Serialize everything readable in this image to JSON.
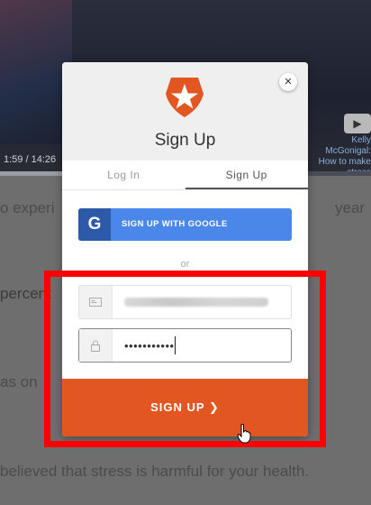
{
  "background": {
    "video_time": "1:59 / 14:26",
    "line_1": "o experi",
    "line_1_right": "year",
    "line_2": "percent",
    "line_3": "as on",
    "line_4": "believed that stress is harmful for your health.",
    "side_text": "Kelly McGonigal: How to make stress"
  },
  "modal": {
    "title": "Sign Up",
    "close_symbol": "×",
    "tabs": [
      {
        "label": "Log In",
        "active": false
      },
      {
        "label": "Sign Up",
        "active": true
      }
    ],
    "google_button": {
      "icon_letter": "G",
      "label": "SIGN UP WITH GOOGLE"
    },
    "separator": "or",
    "email_field": {
      "value": "",
      "blurred": true
    },
    "password_field": {
      "value": "•••••••••••"
    },
    "submit": {
      "label": "SIGN UP ❯"
    }
  },
  "colors": {
    "brand": "#e25622",
    "google": "#4a87e8",
    "highlight": "#ff0000"
  }
}
